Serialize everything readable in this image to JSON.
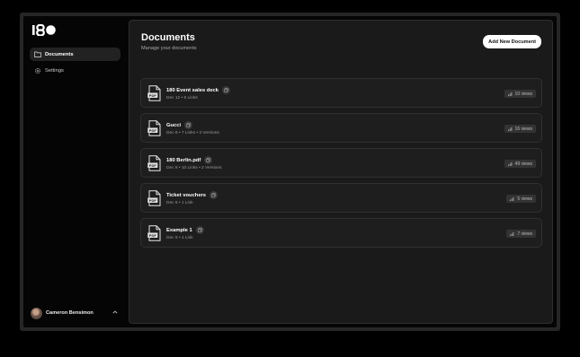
{
  "brand": {
    "logo_text": "180"
  },
  "sidebar": {
    "items": [
      {
        "label": "Documents",
        "icon": "folder-icon",
        "active": true
      },
      {
        "label": "Settings",
        "icon": "gear-icon",
        "active": false
      }
    ],
    "user": {
      "name": "Cameron Bensimon"
    }
  },
  "main": {
    "title": "Documents",
    "subtitle": "Manage your documents",
    "add_button": "Add New Document"
  },
  "documents": [
    {
      "name": "180 Event sales deck",
      "meta": "Dec 12 • 5 Links",
      "views": "10 views"
    },
    {
      "name": "Gucci",
      "meta": "Dec 8 • 7 Links • 3 Versions",
      "views": "16 views"
    },
    {
      "name": "180 Berlin.pdf",
      "meta": "Dec 8 • 10 Links • 2 Versions",
      "views": "49 views"
    },
    {
      "name": "Ticket vouchers",
      "meta": "Dec 6 • 1 Link",
      "views": "5 views"
    },
    {
      "name": "Example 1",
      "meta": "Dec 5 • 1 Link",
      "views": "7 views"
    }
  ]
}
